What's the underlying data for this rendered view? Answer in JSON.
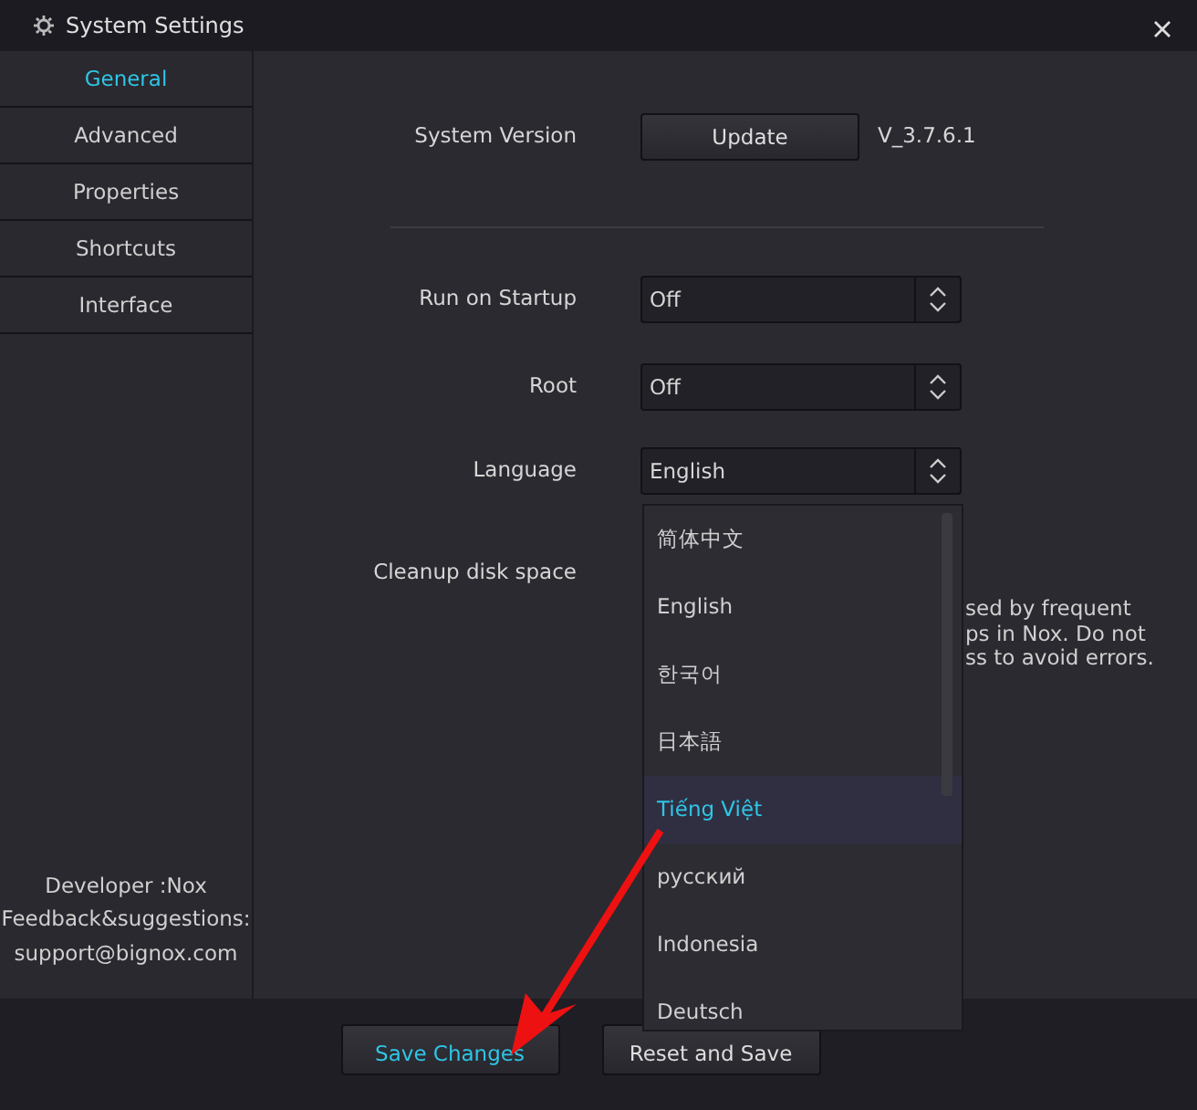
{
  "window": {
    "title": "System Settings"
  },
  "sidebar": {
    "items": [
      {
        "label": "General",
        "selected": true
      },
      {
        "label": "Advanced",
        "selected": false
      },
      {
        "label": "Properties",
        "selected": false
      },
      {
        "label": "Shortcuts",
        "selected": false
      },
      {
        "label": "Interface",
        "selected": false
      }
    ],
    "footer": [
      "Developer :Nox",
      "Feedback&suggestions:",
      "support@bignox.com"
    ]
  },
  "version_row": {
    "label": "System Version",
    "button": "Update",
    "version": "V_3.7.6.1"
  },
  "settings": [
    {
      "label": "Run on Startup",
      "value": "Off"
    },
    {
      "label": "Root",
      "value": "Off"
    },
    {
      "label": "Language",
      "value": "English"
    }
  ],
  "cleanup": {
    "label": "Cleanup disk space",
    "description_lines": [
      "sed by frequent",
      "ps in Nox. Do not",
      "ss to avoid errors."
    ]
  },
  "language_menu": {
    "options": [
      {
        "label": "简体中文",
        "selected": false
      },
      {
        "label": "English",
        "selected": false
      },
      {
        "label": "한국어",
        "selected": false
      },
      {
        "label": "日本語",
        "selected": false
      },
      {
        "label": "Tiếng Việt",
        "selected": true
      },
      {
        "label": "русский",
        "selected": false
      },
      {
        "label": "Indonesia",
        "selected": false
      },
      {
        "label": "Deutsch",
        "selected": false
      }
    ]
  },
  "buttons": [
    "Save Changes",
    "Reset and Save"
  ],
  "annotation": {
    "kind": "arrow"
  }
}
